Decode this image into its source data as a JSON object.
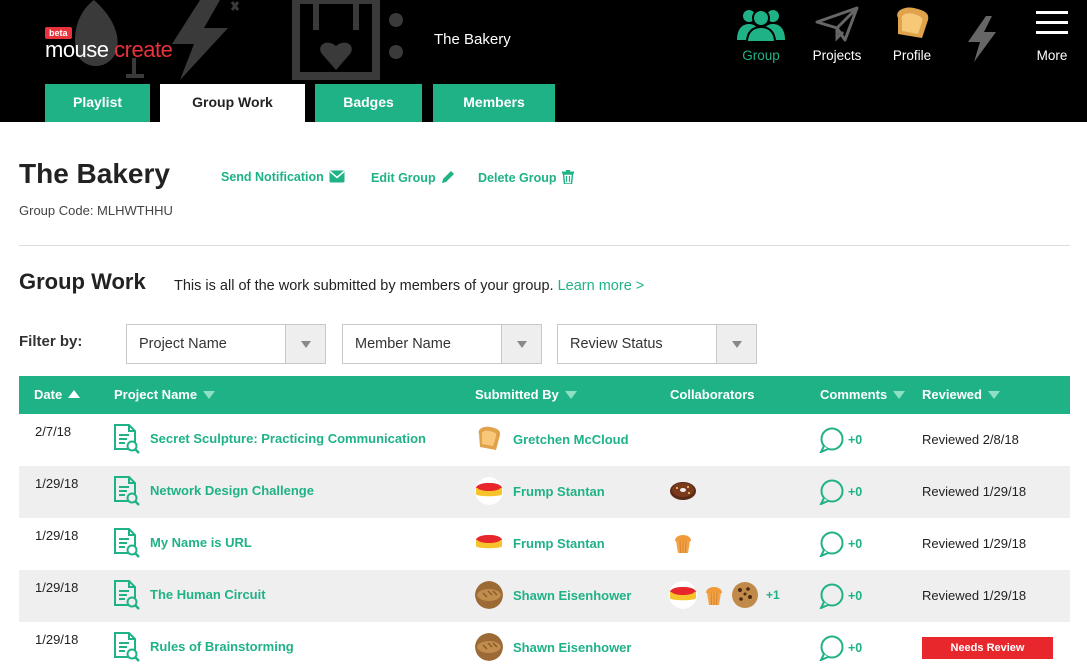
{
  "header": {
    "logo_beta": "beta",
    "logo_mouse": "mouse ",
    "logo_create": "create",
    "group_name": "The Bakery",
    "nav": [
      {
        "label": "Group",
        "icon": "group-icon",
        "active": true
      },
      {
        "label": "Projects",
        "icon": "paper-plane-icon",
        "active": false
      },
      {
        "label": "Profile",
        "icon": "toast-avatar-icon",
        "active": false
      },
      {
        "label": "",
        "icon": "lightning-icon",
        "active": false
      },
      {
        "label": "More",
        "icon": "hamburger-menu-icon",
        "active": false
      }
    ],
    "tabs": [
      {
        "label": "Playlist",
        "active": false
      },
      {
        "label": "Group Work",
        "active": true
      },
      {
        "label": "Badges",
        "active": false
      },
      {
        "label": "Members",
        "active": false
      }
    ]
  },
  "group": {
    "title": "The Bakery",
    "send_notification": "Send Notification",
    "edit_group": "Edit Group",
    "delete_group": "Delete Group",
    "code": "Group Code: MLHWTHHU"
  },
  "section": {
    "title": "Group Work",
    "description": "This is all of the work submitted by members of your group. ",
    "learn_more": "Learn more >"
  },
  "filters": {
    "label": "Filter by:",
    "project": "Project Name",
    "member": "Member Name",
    "status": "Review Status"
  },
  "table": {
    "headers": {
      "date": "Date",
      "project": "Project Name",
      "submitted_by": "Submitted By",
      "collaborators": "Collaborators",
      "comments": "Comments",
      "reviewed": "Reviewed"
    },
    "rows": [
      {
        "date": "2/7/18",
        "project": "Secret Sculpture: Practicing Communication",
        "submitter": "Gretchen McCloud",
        "avatar": "toast-icon",
        "collaborators": [],
        "comments": "+0",
        "reviewed": "Reviewed 2/8/18"
      },
      {
        "date": "1/29/18",
        "project": "Network Design Challenge",
        "submitter": "Frump Stantan",
        "avatar": "cake-icon",
        "collaborators": [
          "donut-icon"
        ],
        "comments": "+0",
        "reviewed": "Reviewed 1/29/18"
      },
      {
        "date": "1/29/18",
        "project": "My Name is URL",
        "submitter": "Frump Stantan",
        "avatar": "cake-icon",
        "collaborators": [
          "muffin-icon"
        ],
        "comments": "+0",
        "reviewed": "Reviewed 1/29/18"
      },
      {
        "date": "1/29/18",
        "project": "The Human Circuit",
        "submitter": "Shawn Eisenhower",
        "avatar": "bread-loaf-icon",
        "collaborators": [
          "cake-icon",
          "muffin-icon",
          "cookie-icon"
        ],
        "collaborators_more": "+1",
        "comments": "+0",
        "reviewed": "Reviewed 1/29/18"
      },
      {
        "date": "1/29/18",
        "project": "Rules of Brainstorming",
        "submitter": "Shawn Eisenhower",
        "avatar": "bread-loaf-icon",
        "collaborators": [],
        "comments": "+0",
        "reviewed": "Needs Review",
        "needs_review": true
      }
    ]
  },
  "colors": {
    "accent": "#1fb287",
    "header_bg": "#000000",
    "alert": "#e8272d",
    "row_shade": "#efefef"
  }
}
